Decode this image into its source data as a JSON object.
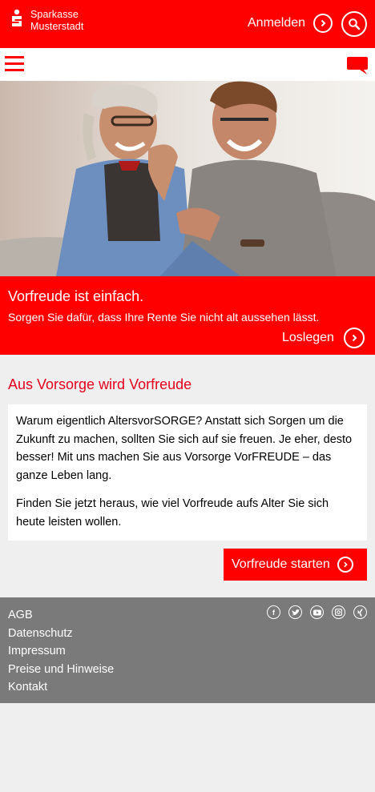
{
  "header": {
    "logo_line1": "Sparkasse",
    "logo_line2": "Musterstadt",
    "login_label": "Anmelden"
  },
  "banner": {
    "title": "Vorfreude ist einfach.",
    "subtitle": "Sorgen Sie dafür, dass Ihre Rente Sie nicht alt aussehen lässt.",
    "cta": "Loslegen"
  },
  "main": {
    "heading": "Aus Vorsorge wird Vorfreude",
    "paragraph1": "Warum eigentlich AltersvorSORGE? Anstatt sich Sorgen um die Zukunft zu machen, sollten Sie sich auf sie freuen. Je eher, desto besser! Mit uns machen Sie aus Vorsorge VorFREUDE – das ganze Leben lang.",
    "paragraph2": "Finden Sie jetzt heraus, wie viel Vorfreude aufs Alter Sie sich heute leisten wollen.",
    "cta": "Vorfreude starten"
  },
  "footer": {
    "links": [
      "AGB",
      "Datenschutz",
      "Impressum",
      "Preise und Hinweise",
      "Kontakt"
    ],
    "social_icons": [
      "facebook-icon",
      "twitter-icon",
      "youtube-icon",
      "instagram-icon",
      "xing-icon"
    ]
  },
  "colors": {
    "brand_red": "#ff0000",
    "heading_red": "#e3001b",
    "footer_gray": "#7a7a7a",
    "page_bg": "#efefef"
  }
}
